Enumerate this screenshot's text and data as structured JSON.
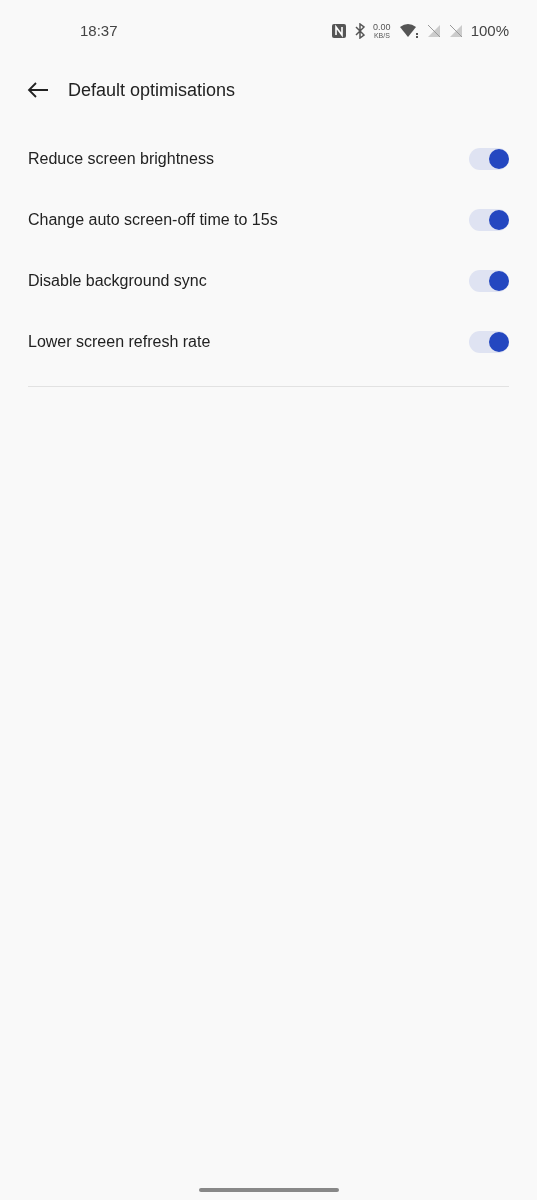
{
  "status_bar": {
    "time": "18:37",
    "speed_value": "0.00",
    "speed_unit": "KB/S",
    "battery": "100%"
  },
  "header": {
    "title": "Default optimisations"
  },
  "options": [
    {
      "label": "Reduce screen brightness",
      "on": true
    },
    {
      "label": "Change auto screen-off time to 15s",
      "on": true
    },
    {
      "label": "Disable background sync",
      "on": true
    },
    {
      "label": "Lower screen refresh rate",
      "on": true
    }
  ]
}
